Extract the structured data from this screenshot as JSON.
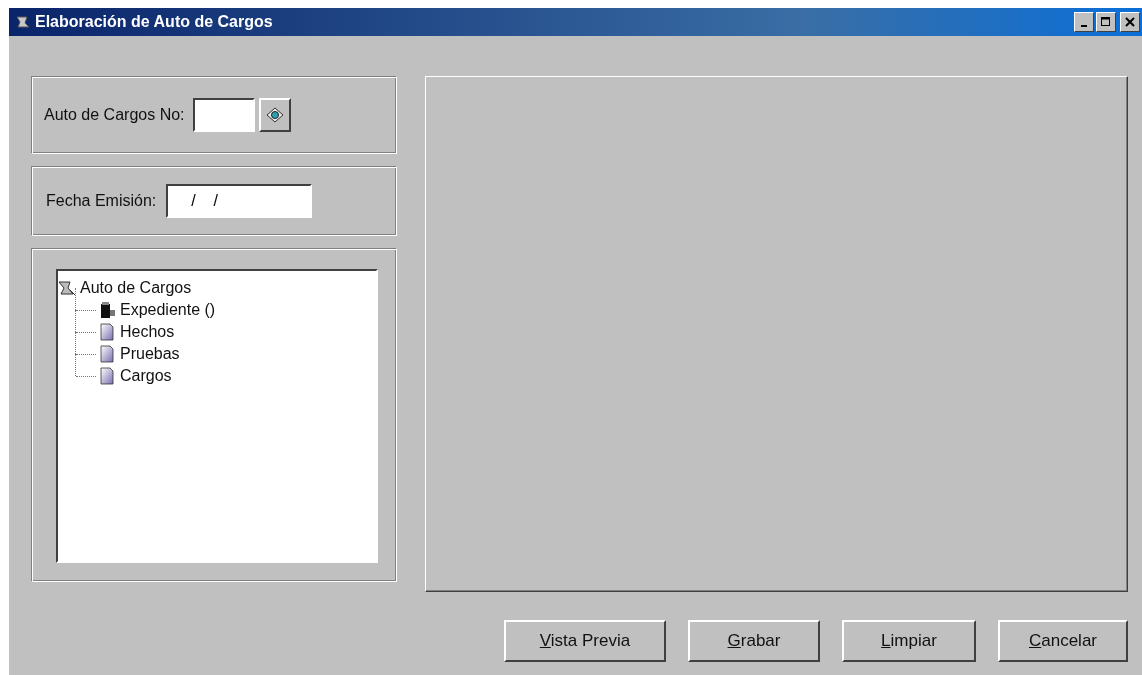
{
  "window": {
    "title": "Elaboración de Auto de Cargos"
  },
  "auto_number": {
    "label": "Auto de Cargos No:"
  },
  "issue_date": {
    "label": "Fecha Emisión:",
    "value": "  /    /"
  },
  "tree": {
    "label": "Auto de Cargos",
    "children": [
      {
        "label": "Expediente ()",
        "kind": "binder"
      },
      {
        "label": "Hechos",
        "kind": "page"
      },
      {
        "label": "Pruebas",
        "kind": "page"
      },
      {
        "label": "Cargos",
        "kind": "page"
      }
    ]
  },
  "buttons": [
    "Vista Previa",
    "Grabar",
    "Limpiar",
    "Cancelar"
  ]
}
